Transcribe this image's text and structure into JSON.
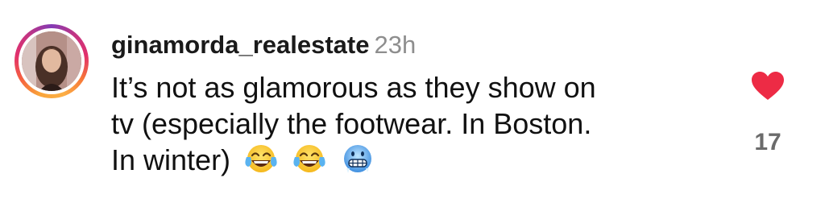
{
  "comment": {
    "username": "ginamorda_realestate",
    "time": "23h",
    "text_lines": [
      "It’s not as glamorous as they show on",
      "tv (especially the footwear. In Boston.",
      "In winter)"
    ],
    "emojis": [
      "face-with-tears-of-joy",
      "face-with-tears-of-joy",
      "cold-face"
    ],
    "likes": "17",
    "liked": true
  },
  "colors": {
    "heart": "#ed2b45",
    "username": "#1a1a1a",
    "time": "#8e8e8e",
    "like_count": "#6b6b6b"
  }
}
